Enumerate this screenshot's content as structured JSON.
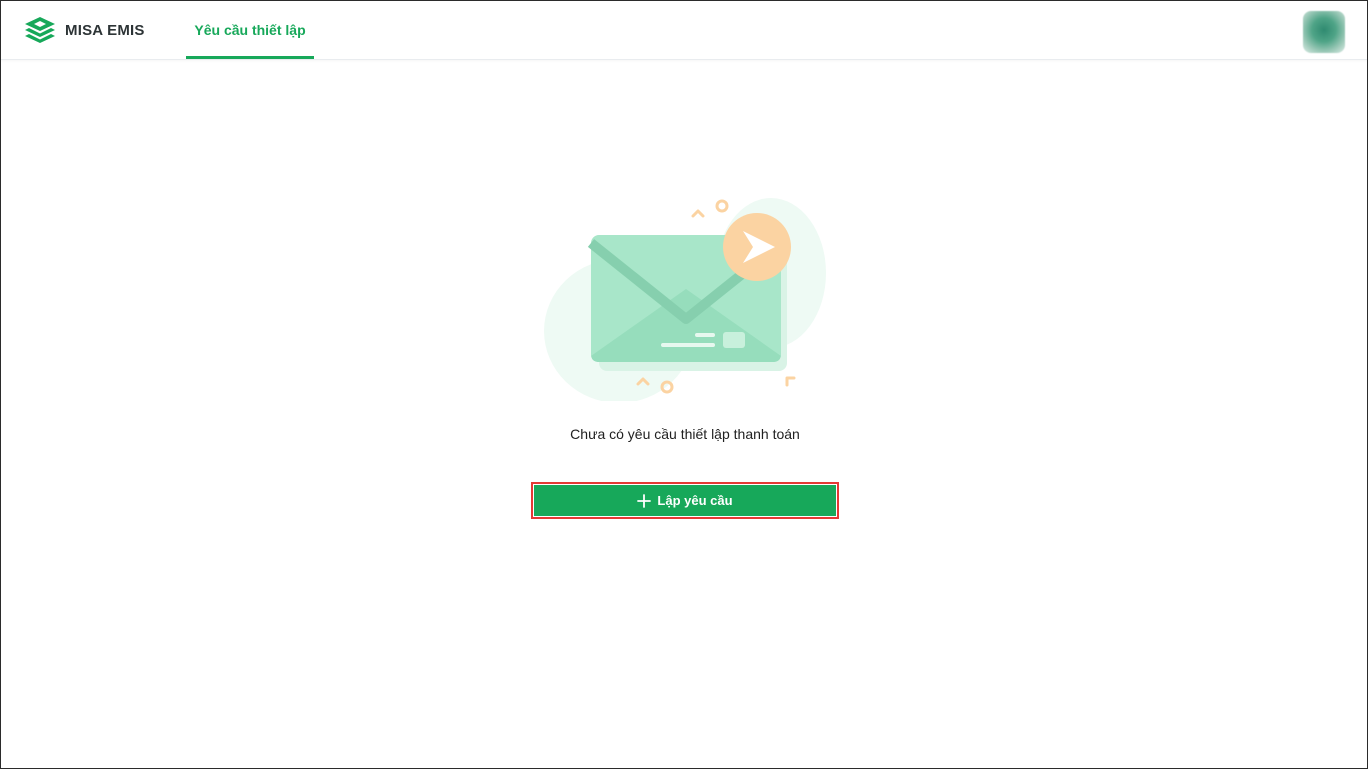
{
  "app": {
    "brand_name": "MISA EMIS"
  },
  "header": {
    "tabs": [
      {
        "label": "Yêu cầu thiết lập",
        "active": true
      }
    ]
  },
  "empty_state": {
    "message": "Chưa có yêu cầu thiết lập thanh toán",
    "illustration_icon": "envelope-send-icon"
  },
  "actions": {
    "create_request_label": "Lập yêu cầu",
    "create_request_icon": "plus-icon"
  },
  "colors": {
    "accent_green": "#17a85a",
    "highlight_border": "#e53935",
    "envelope_green": "#a8e6c9",
    "badge_orange": "#fbd3a2"
  }
}
